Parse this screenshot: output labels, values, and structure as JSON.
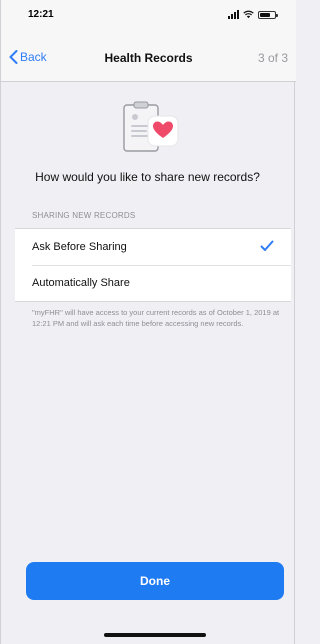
{
  "status_bar": {
    "time": "12:21"
  },
  "nav": {
    "back_label": "Back",
    "title": "Health Records",
    "step": "3 of 3"
  },
  "question": "How would you like to share new records?",
  "section_header": "SHARING NEW RECORDS",
  "options": [
    {
      "label": "Ask Before Sharing",
      "selected": true
    },
    {
      "label": "Automatically Share",
      "selected": false
    }
  ],
  "footnote": "\"myFHR\" will have access to your current records as of October 1, 2019 at 12:21 PM and will ask each time before accessing new records.",
  "done_label": "Done",
  "colors": {
    "accent": "#1f7bf2",
    "heart": "#f04a6a",
    "background": "#efeff4"
  },
  "icons": {
    "back": "chevron-left-icon",
    "check": "checkmark-icon",
    "illustration": "clipboard-heart-icon"
  }
}
